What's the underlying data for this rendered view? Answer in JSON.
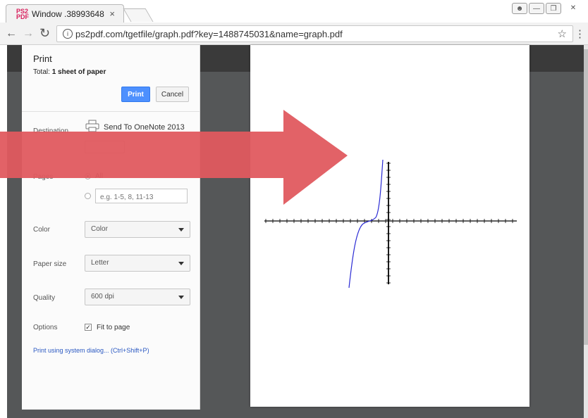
{
  "browser": {
    "tab_title": "Window .38993648",
    "tab_favicon_text": "PS2 PDF",
    "tab_close": "×",
    "url": "ps2pdf.com/tgetfile/graph.pdf?key=1488745031&name=graph.pdf",
    "icons": [
      "back-icon",
      "forward-icon",
      "reload-icon",
      "info-icon",
      "star-icon",
      "menu-icon"
    ]
  },
  "print": {
    "title": "Print",
    "total_prefix": "Total: ",
    "total_value": "1 sheet of paper",
    "print_button": "Print",
    "cancel_button": "Cancel",
    "destination_label": "Destination",
    "destination_value": "Send To OneNote 2013",
    "pages_label": "Pages",
    "pages_all": "All",
    "pages_placeholder": "e.g. 1-5, 8, 11-13",
    "color_label": "Color",
    "color_value": "Color",
    "paper_size_label": "Paper size",
    "paper_size_value": "Letter",
    "quality_label": "Quality",
    "quality_value": "600 dpi",
    "options_label": "Options",
    "fit_to_page": "Fit to page",
    "fit_to_page_checked": true,
    "system_dialog_link": "Print using system dialog... (Ctrl+Shift+P)"
  },
  "overlay": {
    "arrow_color": "#e05a5f"
  },
  "preview": {
    "curve_color": "#2b2bd4"
  }
}
